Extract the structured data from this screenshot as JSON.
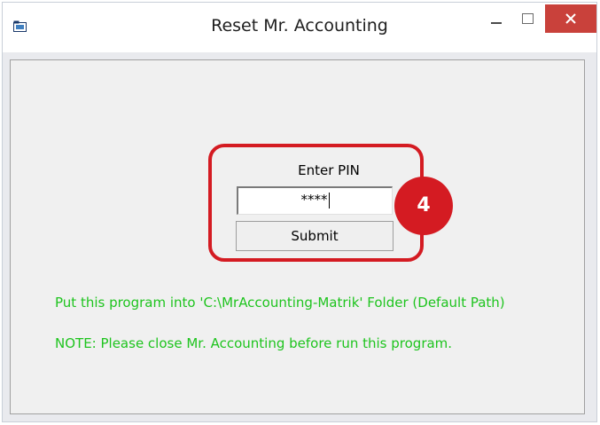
{
  "window": {
    "title": "Reset Mr. Accounting",
    "controls": {
      "minimize": "minimize",
      "maximize": "maximize",
      "close": "close"
    }
  },
  "form": {
    "pin_label": "Enter PIN",
    "pin_value": "****",
    "submit_label": "Submit"
  },
  "annotation": {
    "step": "4",
    "color": "#d41b22"
  },
  "messages": {
    "path_note": "Put this program into 'C:\\MrAccounting-Matrik' Folder (Default Path)",
    "close_note": "NOTE: Please close Mr. Accounting before run this program.",
    "color": "#1ec41e"
  }
}
